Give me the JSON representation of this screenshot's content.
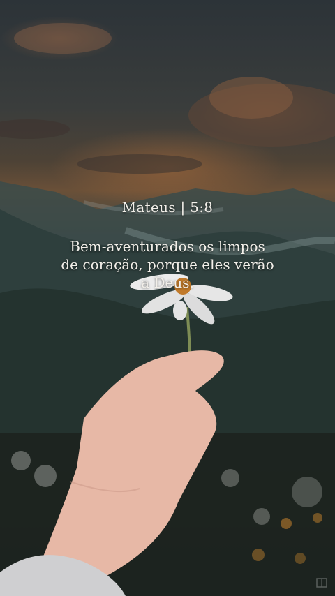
{
  "post": {
    "reference": "Mateus | 5:8",
    "verse_lines": [
      "Bem-aventurados os limpos",
      "de coração, porque eles verão",
      "a Deus."
    ]
  },
  "colors": {
    "text": "#f2efe9",
    "sky_glow": "#b06e3c",
    "petal": "#ececec",
    "flower_center": "#c17a2a"
  },
  "icons": {
    "watermark": "app-logo-icon"
  }
}
